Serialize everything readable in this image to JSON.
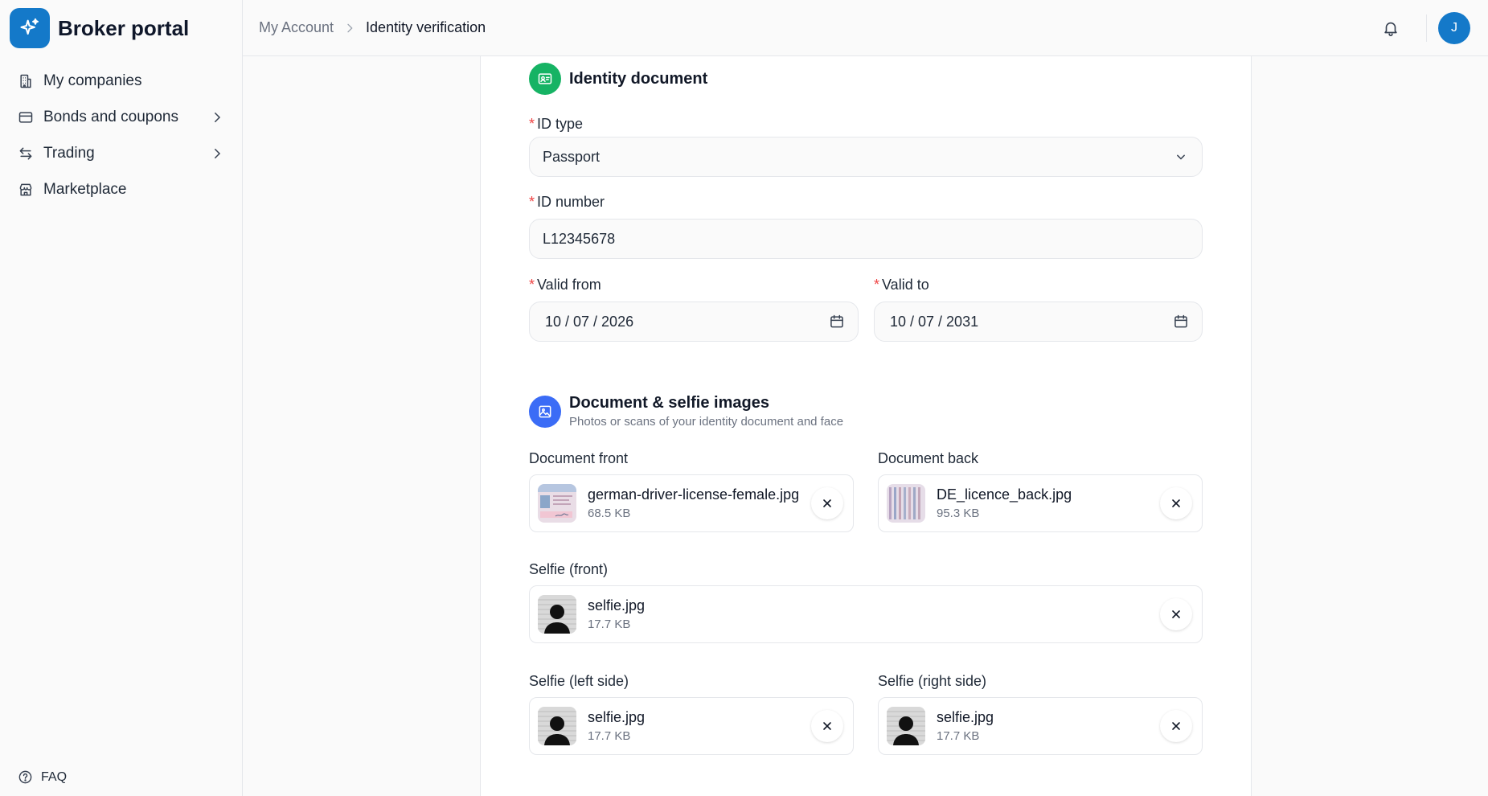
{
  "app": {
    "brand": "Broker portal"
  },
  "sidebar": {
    "items": [
      {
        "label": "My companies",
        "icon": "building-icon",
        "expandable": false
      },
      {
        "label": "Bonds and coupons",
        "icon": "card-icon",
        "expandable": true
      },
      {
        "label": "Trading",
        "icon": "arrows-swap-icon",
        "expandable": true
      },
      {
        "label": "Marketplace",
        "icon": "store-icon",
        "expandable": false
      }
    ],
    "faq": "FAQ"
  },
  "header": {
    "breadcrumb": {
      "parent": "My Account",
      "current": "Identity verification"
    },
    "avatar_initial": "J"
  },
  "identity": {
    "title": "Identity document",
    "id_type": {
      "label": "ID type",
      "value": "Passport"
    },
    "id_number": {
      "label": "ID number",
      "value": "L12345678"
    },
    "valid_from": {
      "label": "Valid from",
      "value": "10 / 07 / 2026"
    },
    "valid_to": {
      "label": "Valid to",
      "value": "10 / 07 / 2031"
    }
  },
  "images": {
    "title": "Document & selfie images",
    "subtitle": "Photos or scans of your identity document and face",
    "doc_front": {
      "label": "Document front",
      "file": "german-driver-license-female.jpg",
      "size": "68.5 KB"
    },
    "doc_back": {
      "label": "Document back",
      "file": "DE_licence_back.jpg",
      "size": "95.3 KB"
    },
    "selfie_front": {
      "label": "Selfie (front)",
      "file": "selfie.jpg",
      "size": "17.7 KB"
    },
    "selfie_left": {
      "label": "Selfie (left side)",
      "file": "selfie.jpg",
      "size": "17.7 KB"
    },
    "selfie_right": {
      "label": "Selfie (right side)",
      "file": "selfie.jpg",
      "size": "17.7 KB"
    }
  },
  "colors": {
    "brand": "#1479c9",
    "identity_icon_bg": "#16b364",
    "images_icon_bg": "#3b6cf6",
    "required": "#ef4444"
  }
}
